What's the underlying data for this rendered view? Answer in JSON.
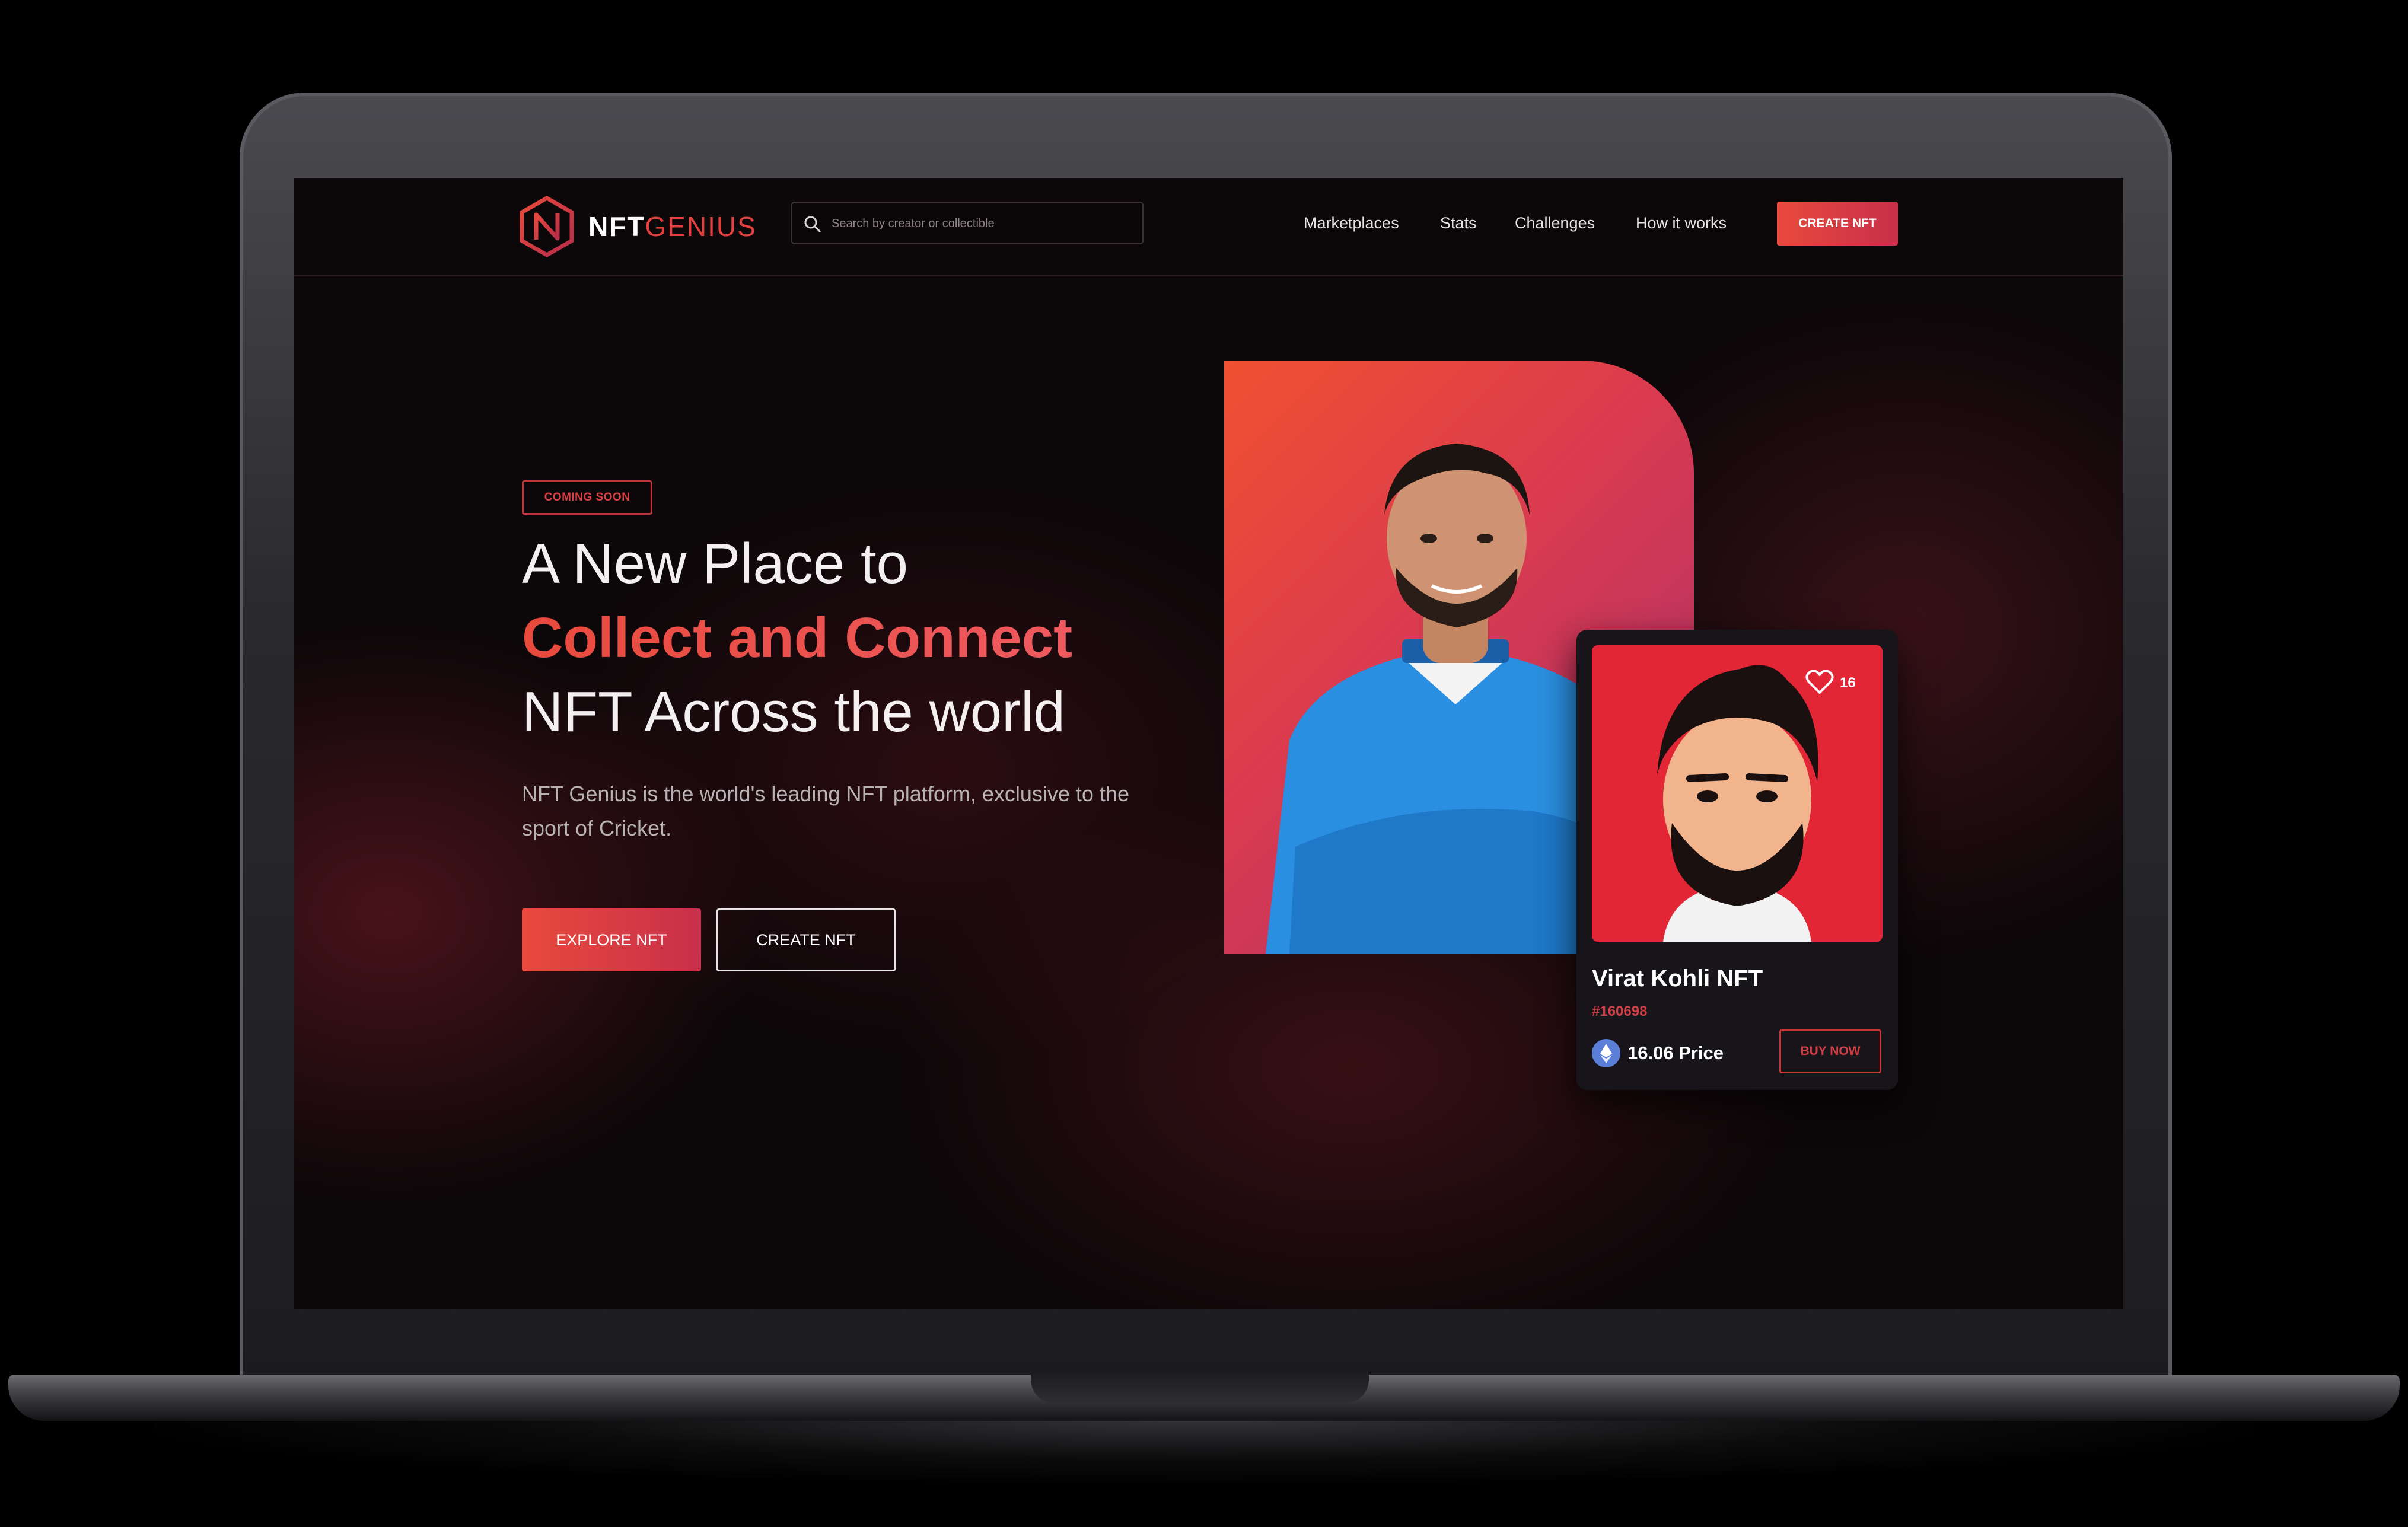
{
  "brand": {
    "name_main": "NFT",
    "name_accent": "GENIUS"
  },
  "search": {
    "placeholder": "Search by creator or collectible"
  },
  "nav": {
    "links": [
      "Marketplaces",
      "Stats",
      "Challenges",
      "How it works"
    ],
    "cta_label": "CREATE NFT"
  },
  "hero": {
    "badge": "COMING SOON",
    "headline_line1": "A New Place to",
    "headline_line2": "Collect and Connect",
    "headline_line3": "NFT Across the world",
    "description": "NFT Genius is the world's leading NFT platform, exclusive to the sport of Cricket.",
    "explore_label": "EXPLORE NFT",
    "create_label": "CREATE NFT"
  },
  "card": {
    "likes": "16",
    "title": "Virat Kohli NFT",
    "id": "#160698",
    "price": "16.06 Price",
    "buy_label": "BUY NOW"
  },
  "colors": {
    "accent": "#e84a3c",
    "accent_alt": "#c92f4a",
    "background": "#0c0709",
    "card_art": "#e32636"
  },
  "icons": [
    "nftgenius-logo-icon",
    "search-icon",
    "heart-icon",
    "ethereum-icon"
  ]
}
